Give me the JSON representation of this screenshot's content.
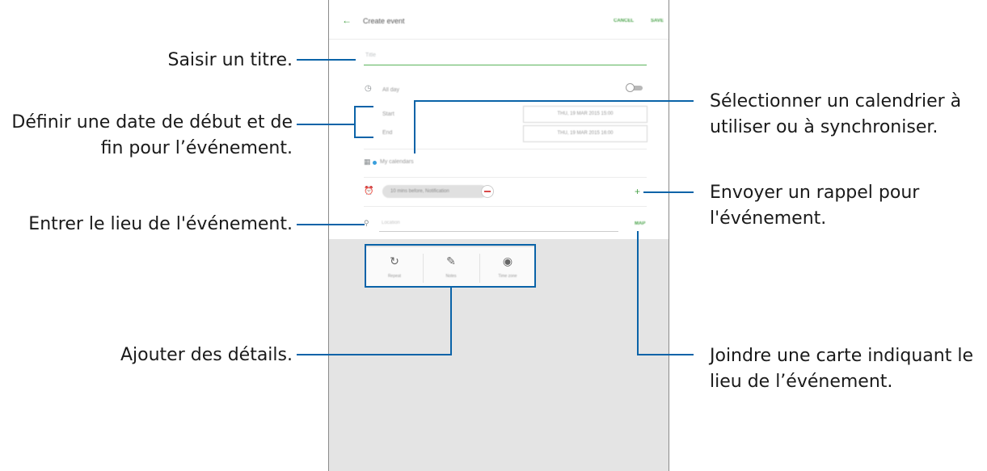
{
  "screen": {
    "topbar": {
      "title": "Create event",
      "cancel": "CANCEL",
      "save": "SAVE"
    },
    "title_placeholder": "Title",
    "all_day_label": "All day",
    "start_label": "Start",
    "start_value": "THU, 19 MAR 2015   15:00",
    "end_label": "End",
    "end_value": "THU, 19 MAR 2015   16:00",
    "calendar_label": "My calendars",
    "reminder_chip": "10 mins before, Notification",
    "location_placeholder": "Location",
    "map_button": "MAP",
    "details": [
      {
        "label": "Repeat"
      },
      {
        "label": "Notes"
      },
      {
        "label": "Time zone"
      }
    ]
  },
  "annotations": {
    "title": "Saisir un titre.",
    "dates_line1": "Définir une date de début et de",
    "dates_line2": "fin pour l’événement.",
    "location": "Entrer le lieu de l'événement.",
    "details": "Ajouter des détails.",
    "calendar_line1": "Sélectionner un calendrier à",
    "calendar_line2": "utiliser ou à synchroniser.",
    "reminder_line1": "Envoyer un rappel pour",
    "reminder_line2": "l'événement.",
    "map_line1": "Joindre une carte indiquant le",
    "map_line2": "lieu de l’événement."
  },
  "colors": {
    "accent": "#4aa34a",
    "callout": "#0a63a8",
    "calendar_dot": "#3a9fdc"
  }
}
